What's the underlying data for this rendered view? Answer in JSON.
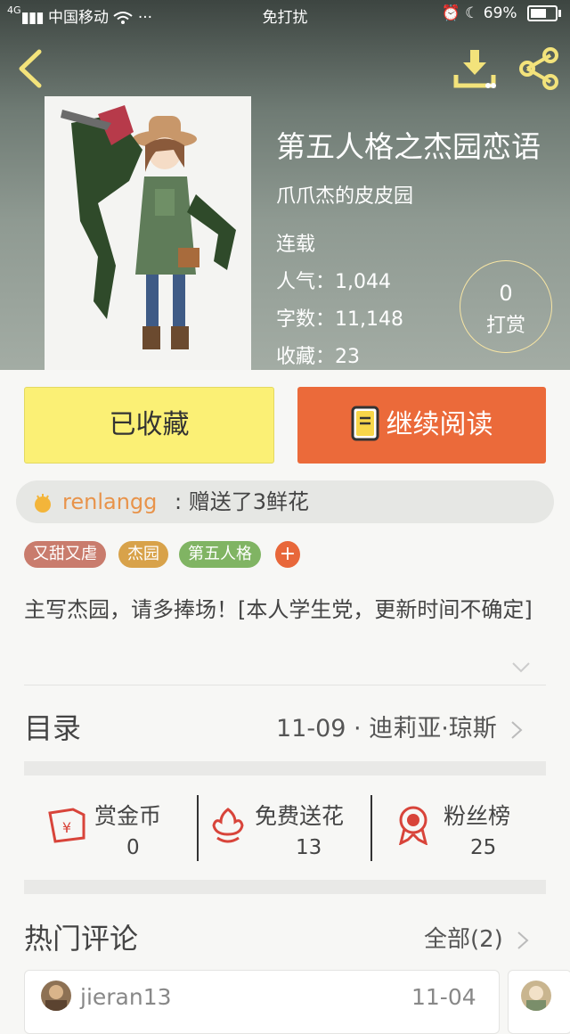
{
  "status_bar": {
    "signal": "4G",
    "carrier": "中国移动",
    "more": "···",
    "mode": "免打扰",
    "battery": "69%"
  },
  "header": {
    "back_icon": "chevron-left-icon",
    "download_icon": "download-icon",
    "share_icon": "share-icon",
    "accent": "#f3e37b"
  },
  "book": {
    "title": "第五人格之杰园恋语",
    "author": "爪爪杰的皮皮园",
    "status": "连载",
    "popularity": "人气：1,044",
    "words": "字数：11,148",
    "favorites": "收藏：23",
    "tip_count": "0",
    "tip_label": "打赏"
  },
  "actions": {
    "collected": "已收藏",
    "continue": "继续阅读"
  },
  "gift": {
    "user": "renlangg",
    "text": ": 赠送了3鲜花"
  },
  "tags": [
    "又甜又虐",
    "杰园",
    "第五人格"
  ],
  "tag_add": "+",
  "description": "主写杰园，请多捧场！[本人学生党，更新时间不确定]",
  "toc": {
    "label": "目录",
    "latest": "11-09 · 迪莉亚·琼斯"
  },
  "ranks": [
    {
      "label": "赏金币",
      "value": "0",
      "icon": "reward-coin-icon"
    },
    {
      "label": "免费送花",
      "value": "13",
      "icon": "flower-icon"
    },
    {
      "label": "粉丝榜",
      "value": "25",
      "icon": "medal-icon"
    }
  ],
  "comments": {
    "title": "热门评论",
    "all": "全部(2)",
    "first": {
      "user": "jieran13",
      "date": "11-04"
    }
  },
  "colors": {
    "collected_bg": "#fbf075",
    "continue_bg": "#eb6a3a",
    "gift_user": "#e8934a"
  }
}
